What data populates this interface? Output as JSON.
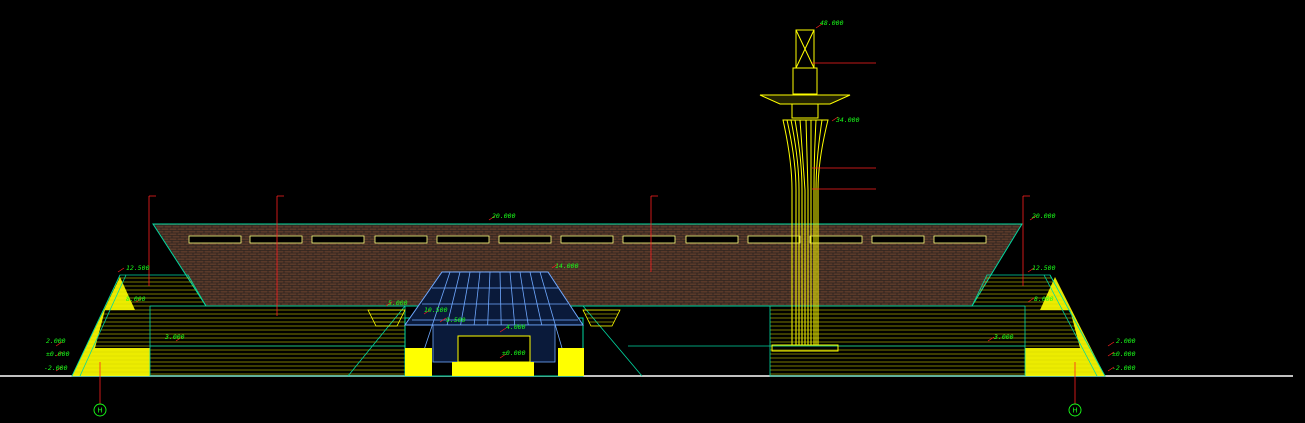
{
  "colors": {
    "background": "#000000",
    "outline": "#ffff00",
    "accent": "#00d7a0",
    "dimension": "#ff2020",
    "label": "#19ff19",
    "glass": "#6fa8ff",
    "ground": "#ffffff"
  },
  "levels": {
    "tower_top": "48.000",
    "tower_mid": "34.000",
    "roof_main": "20.000",
    "roof_right": "20.000",
    "entrance_top": "14.000",
    "left_stair_top": "12.500",
    "right_stair_top": "12.500",
    "left_step": "8.000",
    "right_step": "8.000",
    "entrance_glass": "10.500",
    "glass_left": "5.000",
    "glass_mid": "9.500",
    "entrance_door": "4.000",
    "platform_left": "3.000",
    "platform_right": "3.000",
    "base_left": "2.000",
    "base_right": "2.000",
    "ground_left": "±0.000",
    "ground_right": "±0.000",
    "ground_center": "±0.000",
    "below_left": "-2.000",
    "below_right": "-2.000"
  },
  "axes": {
    "left": "H",
    "right": "H"
  }
}
